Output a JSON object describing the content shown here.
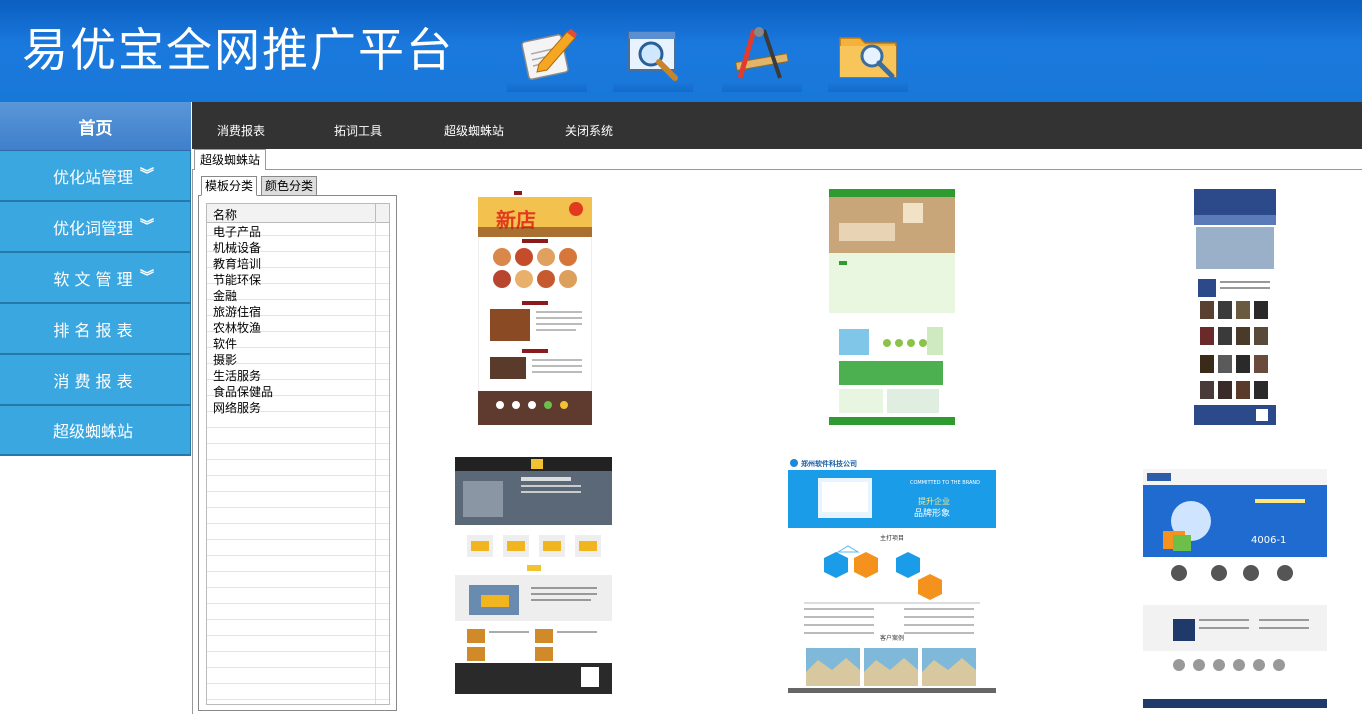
{
  "header": {
    "title": "易优宝全网推广平台",
    "tools": [
      {
        "icon": "edit-note-icon"
      },
      {
        "icon": "search-window-icon"
      },
      {
        "icon": "design-tools-icon"
      },
      {
        "icon": "folder-search-icon"
      }
    ]
  },
  "sidebar": {
    "home": "首页",
    "items": [
      {
        "label": "优化站管理",
        "chevron": "︾"
      },
      {
        "label": "优化词管理",
        "chevron": "︾"
      },
      {
        "label": "软 文 管 理",
        "chevron": "︾"
      },
      {
        "label": "排 名 报 表"
      },
      {
        "label": "消 费 报 表"
      },
      {
        "label": "超级蜘蛛站"
      }
    ]
  },
  "topnav": [
    "消费报表",
    "拓词工具",
    "超级蜘蛛站",
    "关闭系统"
  ],
  "main": {
    "tab": "超级蜘蛛站",
    "subtabs": [
      "模板分类",
      "颜色分类"
    ],
    "list_header": "名称",
    "categories": [
      "电子产品",
      "机械设备",
      "教育培训",
      "节能环保",
      "金融",
      "旅游住宿",
      "农林牧渔",
      "软件",
      "摄影",
      "生活服务",
      "食品保健品",
      "网络服务"
    ]
  },
  "thumbnails": [
    {
      "name": "template-food-shop",
      "text": [
        "新店"
      ]
    },
    {
      "name": "template-home-decor"
    },
    {
      "name": "template-portfolio"
    },
    {
      "name": "template-machinery"
    },
    {
      "name": "template-software-company",
      "text": [
        "郑州软件科技公司",
        "COMMITTED TO THE BRAND",
        "提升企业",
        "品牌形象",
        "主打项目",
        "客户案例"
      ]
    },
    {
      "name": "template-tech-robot",
      "text": [
        "4006-1"
      ]
    }
  ],
  "colors": {
    "header": "#1878d8",
    "sidebar_item": "#3aa7e0",
    "sidebar_home": "#4a88d0",
    "topnav": "#333333"
  }
}
